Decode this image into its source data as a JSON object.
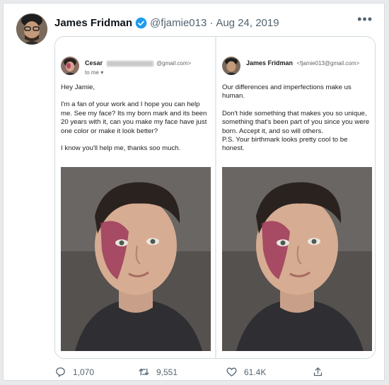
{
  "tweet": {
    "author_name": "James Fridman",
    "handle": "@fjamie013",
    "separator": "·",
    "date": "Aug 24, 2019",
    "more_label": "•••"
  },
  "left_email": {
    "sender_name": "Cesar",
    "sender_domain": "@gmail.com>",
    "to_line": "to me ▾",
    "paragraphs": [
      "Hey Jamie,",
      "I'm a fan of your work and I hope you can help me. See my face? Its my born mark and its been 20 years with it, can you make my face have just one color or make it look better?",
      "I know you'll help me, thanks soo much."
    ]
  },
  "right_email": {
    "sender_name": "James Fridman",
    "sender_address": "<fjamie013@gmail.com>",
    "paragraphs": [
      "Our differences and imperfections make us human.",
      "Don't hide something that makes you so unique, something that's been part of you since you were born. Accept it, and so will others.\nP.S. Your birthmark looks pretty cool to be honest."
    ]
  },
  "actions": {
    "replies": "1,070",
    "retweets": "9,551",
    "likes": "61.4K"
  },
  "colors": {
    "muted_text": "#536471",
    "verified_blue": "#1d9bf0"
  },
  "icons": [
    "verified-icon",
    "more-icon",
    "reply-icon",
    "retweet-icon",
    "like-icon",
    "share-icon"
  ]
}
